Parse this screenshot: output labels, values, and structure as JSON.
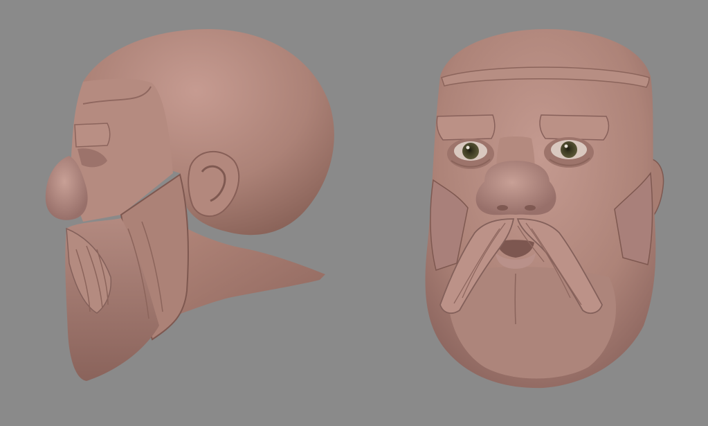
{
  "scene": {
    "background_color": "#8a8a8a",
    "clay_color": "#b0857b",
    "clay_shadow_color": "#7c5a53",
    "clay_highlight_color": "#c9a096",
    "eye_iris_color": "#4c4a2e",
    "models": [
      {
        "name": "head-side-view",
        "view": "profile-left"
      },
      {
        "name": "head-front-view",
        "view": "front"
      }
    ]
  }
}
